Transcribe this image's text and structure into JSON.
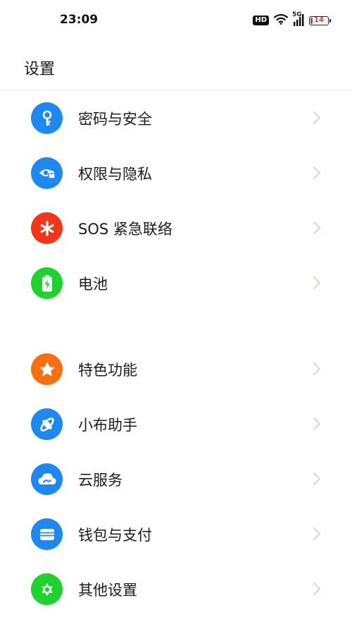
{
  "status_bar": {
    "time": "23:09",
    "hd_label": "HD",
    "network_label": "5G",
    "battery_level": "14",
    "icons": [
      "hd-icon",
      "wifi-icon",
      "cellular-signal-icon",
      "battery-icon"
    ],
    "battery_color": "#e53935"
  },
  "header": {
    "title": "设置"
  },
  "settings_groups": [
    {
      "items": [
        {
          "label": "密码与安全",
          "icon": "key-icon",
          "color": "#1e88f0"
        },
        {
          "label": "权限与隐私",
          "icon": "privacy-eye-icon",
          "color": "#1e88f0"
        },
        {
          "label": "SOS 紧急联络",
          "icon": "asterisk-icon",
          "color": "#f2361c"
        },
        {
          "label": "电池",
          "icon": "battery-charging-icon",
          "color": "#1fd230"
        }
      ]
    },
    {
      "items": [
        {
          "label": "特色功能",
          "icon": "star-icon",
          "color": "#f86f14"
        },
        {
          "label": "小布助手",
          "icon": "assistant-icon",
          "color": "#1e88f0"
        },
        {
          "label": "云服务",
          "icon": "cloud-icon",
          "color": "#1e88f0"
        },
        {
          "label": "钱包与支付",
          "icon": "wallet-icon",
          "color": "#1e88f0"
        },
        {
          "label": "其他设置",
          "icon": "gear-icon",
          "color": "#1fd230"
        }
      ]
    }
  ],
  "chevron_icon": "chevron-right-icon",
  "chevron_color": "#d9d0c0"
}
